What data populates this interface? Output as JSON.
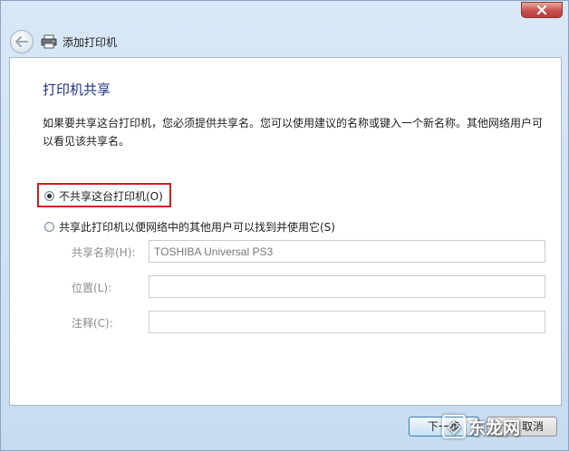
{
  "window": {
    "title": "添加打印机"
  },
  "page": {
    "heading": "打印机共享",
    "description": "如果要共享这台打印机，您必须提供共享名。您可以使用建议的名称或键入一个新名称。其他网络用户可以看见该共享名。"
  },
  "options": {
    "no_share_label": "不共享这台打印机(O)",
    "share_label": "共享此打印机以便网络中的其他用户可以找到并使用它(S)",
    "selected": "no_share"
  },
  "fields": {
    "share_name_label": "共享名称(H):",
    "share_name_value": "TOSHIBA Universal PS3",
    "location_label": "位置(L):",
    "location_value": "",
    "comment_label": "注释(C):",
    "comment_value": ""
  },
  "footer": {
    "next_label": "下一步",
    "cancel_label": "取消"
  },
  "watermark": {
    "text": "东龙网"
  },
  "colors": {
    "heading": "#1e3287",
    "highlight": "#d21e1e",
    "disabled_text": "#8c8c8c"
  }
}
